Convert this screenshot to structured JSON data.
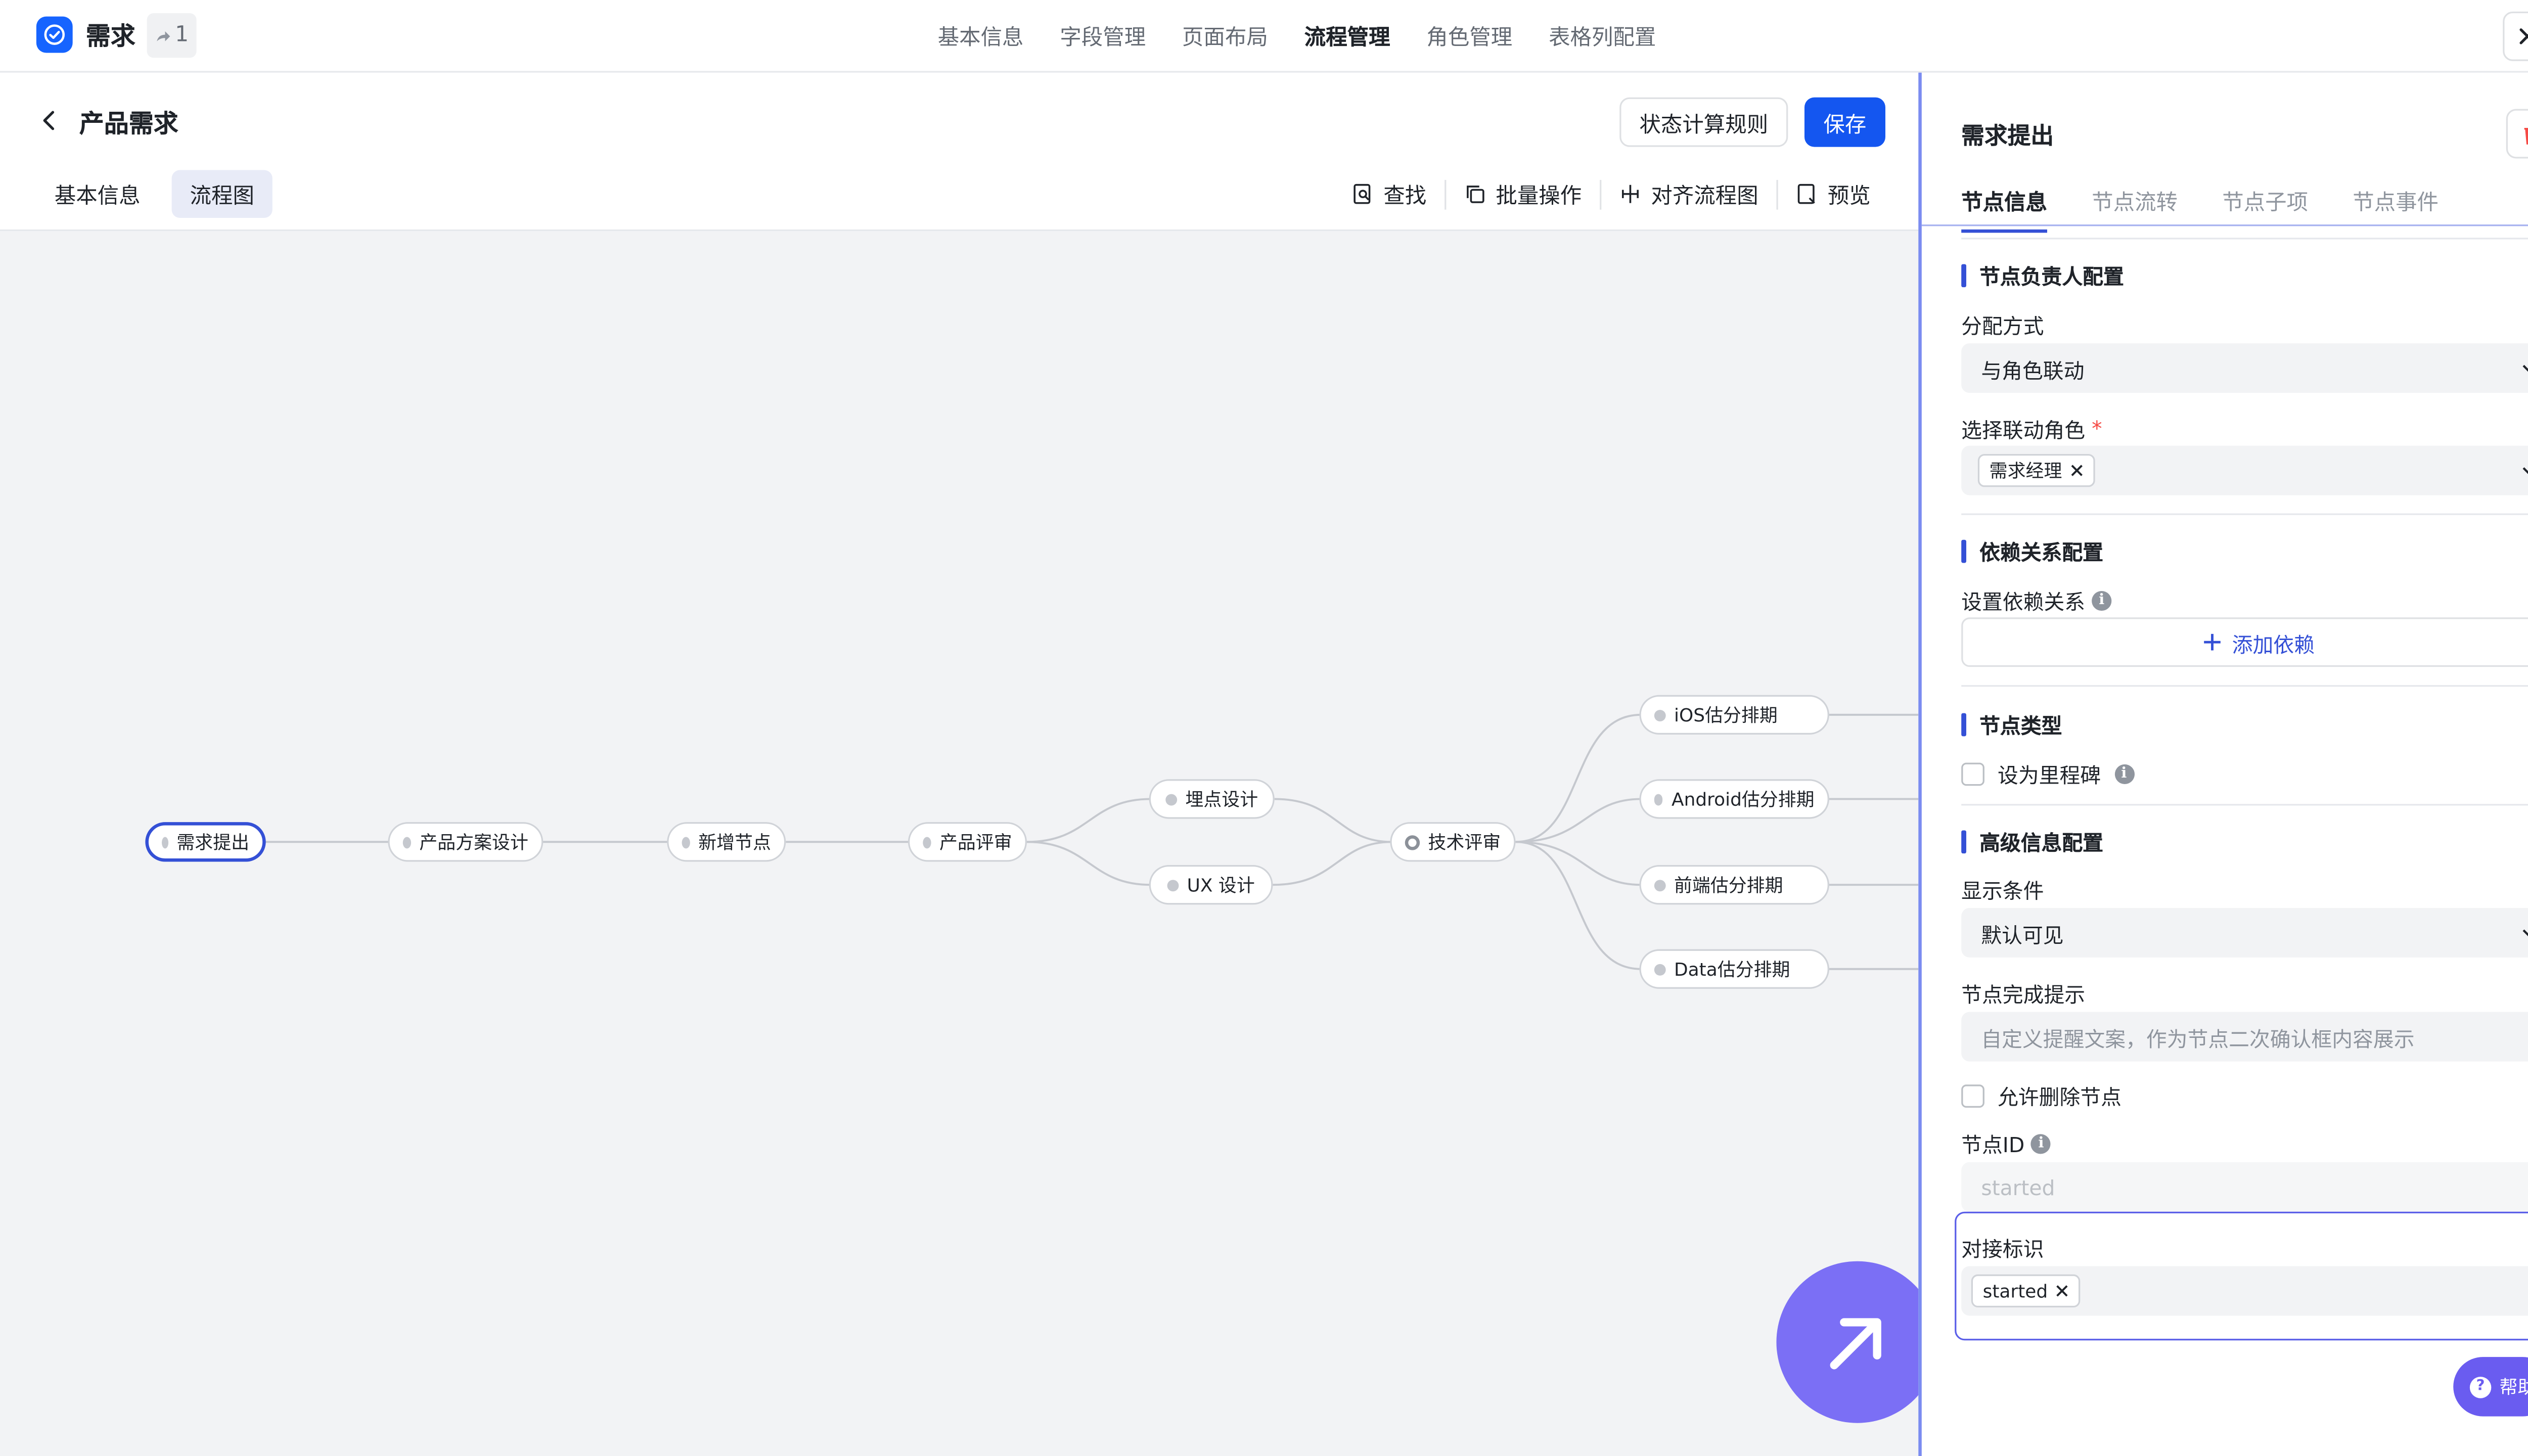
{
  "app": {
    "title": "需求",
    "share_count": "1"
  },
  "top_nav": {
    "items": [
      "基本信息",
      "字段管理",
      "页面布局",
      "流程管理",
      "角色管理",
      "表格列配置"
    ],
    "active": "流程管理"
  },
  "editor": {
    "page_title": "产品需求",
    "rules_button": "状态计算规则",
    "save_button": "保存",
    "sub_tabs": [
      "基本信息",
      "流程图"
    ],
    "active_sub_tab": "流程图",
    "toolbar": {
      "find": "查找",
      "batch": "批量操作",
      "align": "对齐流程图",
      "preview": "预览"
    }
  },
  "flow": {
    "nodes": {
      "n1": "需求提出",
      "n2": "产品方案设计",
      "n3": "新增节点",
      "n4": "产品评审",
      "n5": "埋点设计",
      "n6": "UX 设计",
      "n7": "技术评审",
      "n8": "iOS估分排期",
      "n9": "Android估分排期",
      "n10": "前端估分排期",
      "n11": "Data估分排期"
    },
    "selected": "需求提出"
  },
  "panel": {
    "title": "需求提出",
    "tabs": [
      "节点信息",
      "节点流转",
      "节点子项",
      "节点事件"
    ],
    "active_tab": "节点信息",
    "owner_section": {
      "heading": "节点负责人配置",
      "assign_label": "分配方式",
      "assign_value": "与角色联动",
      "role_label": "选择联动角色",
      "required_mark": "*",
      "role_tag": "需求经理"
    },
    "dependency_section": {
      "heading": "依赖关系配置",
      "label": "设置依赖关系",
      "add_button": "添加依赖"
    },
    "type_section": {
      "heading": "节点类型",
      "milestone_label": "设为里程碑"
    },
    "advanced_section": {
      "heading": "高级信息配置",
      "condition_label": "显示条件",
      "condition_value": "默认可见",
      "tip_label": "节点完成提示",
      "tip_placeholder": "自定义提醒文案，作为节点二次确认框内容展示",
      "allow_delete_label": "允许删除节点",
      "node_id_label": "节点ID",
      "node_id_value": "started",
      "integration_label": "对接标识",
      "integration_tag": "started"
    },
    "help_button": "帮助"
  },
  "colors": {
    "primary": "#1456f0",
    "accent": "#3450d6",
    "fab": "#7b6ff5",
    "danger": "#f54a45"
  }
}
